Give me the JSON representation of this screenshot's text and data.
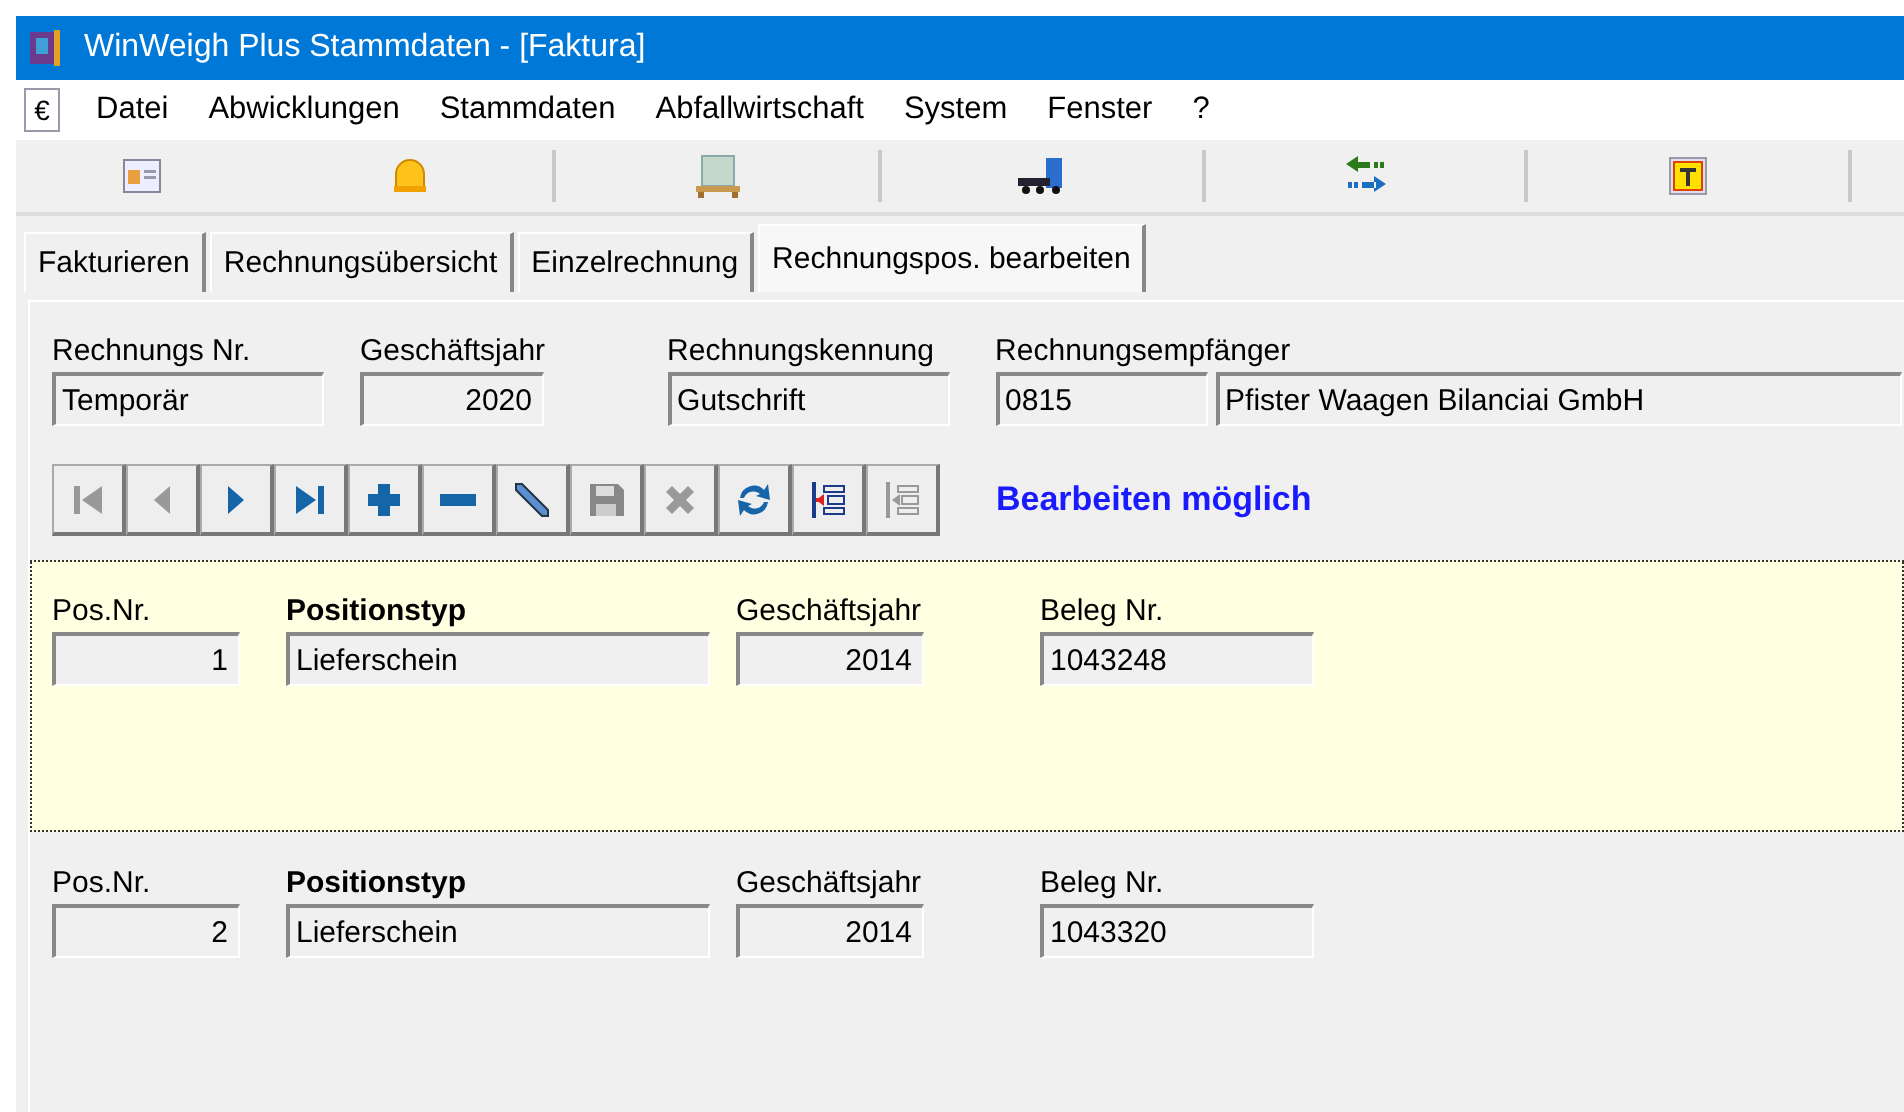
{
  "window": {
    "title": "WinWeigh Plus Stammdaten - [Faktura]"
  },
  "menu": {
    "icon_text": "€",
    "items": [
      "Datei",
      "Abwicklungen",
      "Stammdaten",
      "Abfallwirtschaft",
      "System",
      "Fenster",
      "?"
    ]
  },
  "tabs": [
    {
      "label": "Fakturieren",
      "selected": false
    },
    {
      "label": "Rechnungsübersicht",
      "selected": false
    },
    {
      "label": "Einzelrechnung",
      "selected": false
    },
    {
      "label": "Rechnungspos. bearbeiten",
      "selected": true
    }
  ],
  "header": {
    "fields": [
      {
        "label": "Rechnungs Nr.",
        "values": [
          "Temporär"
        ],
        "kind": "text"
      },
      {
        "label": "Geschäftsjahr",
        "values": [
          "2020"
        ],
        "kind": "number"
      },
      {
        "label": "Rechnungskennung",
        "values": [
          "Gutschrift"
        ],
        "kind": "text"
      },
      {
        "label": "Rechnungsempfänger",
        "values": [
          "0815",
          "Pfister Waagen Bilanciai GmbH"
        ],
        "kind": "text"
      }
    ]
  },
  "navigator": {
    "buttons": [
      {
        "kind": "first",
        "disabled": true
      },
      {
        "kind": "prev",
        "disabled": true
      },
      {
        "kind": "next",
        "disabled": false
      },
      {
        "kind": "last",
        "disabled": false
      },
      {
        "kind": "add",
        "disabled": false
      },
      {
        "kind": "remove",
        "disabled": false
      },
      {
        "kind": "edit",
        "disabled": false
      },
      {
        "kind": "save",
        "disabled": true
      },
      {
        "kind": "cancel",
        "disabled": true
      },
      {
        "kind": "refresh",
        "disabled": false
      },
      {
        "kind": "insert",
        "disabled": false
      },
      {
        "kind": "extract",
        "disabled": true
      }
    ],
    "status": "Bearbeiten möglich"
  },
  "records": [
    {
      "selected": true,
      "fields": [
        {
          "label": "Pos.Nr.",
          "value": "1",
          "kind": "number",
          "bold": false
        },
        {
          "label": "Positionstyp",
          "value": "Lieferschein",
          "kind": "text",
          "bold": true
        },
        {
          "label": "Geschäftsjahr",
          "value": "2014",
          "kind": "number",
          "bold": false
        },
        {
          "label": "Beleg Nr.",
          "value": "1043248",
          "kind": "text",
          "bold": false
        }
      ]
    },
    {
      "selected": false,
      "fields": [
        {
          "label": "Pos.Nr.",
          "value": "2",
          "kind": "number",
          "bold": false
        },
        {
          "label": "Positionstyp",
          "value": "Lieferschein",
          "kind": "text",
          "bold": true
        },
        {
          "label": "Geschäftsjahr",
          "value": "2014",
          "kind": "number",
          "bold": false
        },
        {
          "label": "Beleg Nr.",
          "value": "1043320",
          "kind": "text",
          "bold": false
        }
      ]
    }
  ]
}
